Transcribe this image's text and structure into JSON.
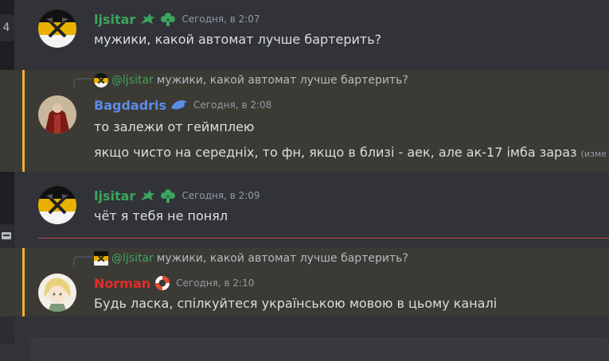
{
  "colors": {
    "bg": "#313338",
    "highlight": "#3c3a35",
    "reply_bar": "#f0b232",
    "green_name": "#3ba55d",
    "blue_name": "#5b8ce8",
    "red_name": "#e32b2b",
    "timestamp": "#949ba4"
  },
  "sidebar": {
    "top_icon": "4",
    "icons": [
      "keyboard-icon",
      "phone-icon"
    ]
  },
  "messages": [
    {
      "author": "ljsitar",
      "timestamp": "Сегодня, в 2:07",
      "lines": [
        "мужики, какой автомат лучше бартерить?"
      ]
    },
    {
      "reply_to": {
        "mention": "@ljsitar",
        "text": "мужики, какой автомат лучше бартерить?"
      },
      "author": "Bagdadris",
      "timestamp": "Сегодня, в 2:08",
      "lines": [
        "то залежи от геймплею",
        "якщо чисто на середніх, то фн, якщо в близі - аек, але ак-17 імба зараз"
      ],
      "edited_label": "(изме"
    },
    {
      "author": "ljsitar",
      "timestamp": "Сегодня, в 2:09",
      "lines": [
        "чёт я тебя не понял"
      ]
    },
    {
      "reply_to": {
        "mention": "@ljsitar",
        "text": "мужики, какой автомат лучше бартерить?"
      },
      "author": "Norman",
      "timestamp": "Сегодня, в 2:10",
      "lines": [
        "Будь ласка, спілкуйтеся українською мовою в цьому каналі"
      ]
    }
  ]
}
